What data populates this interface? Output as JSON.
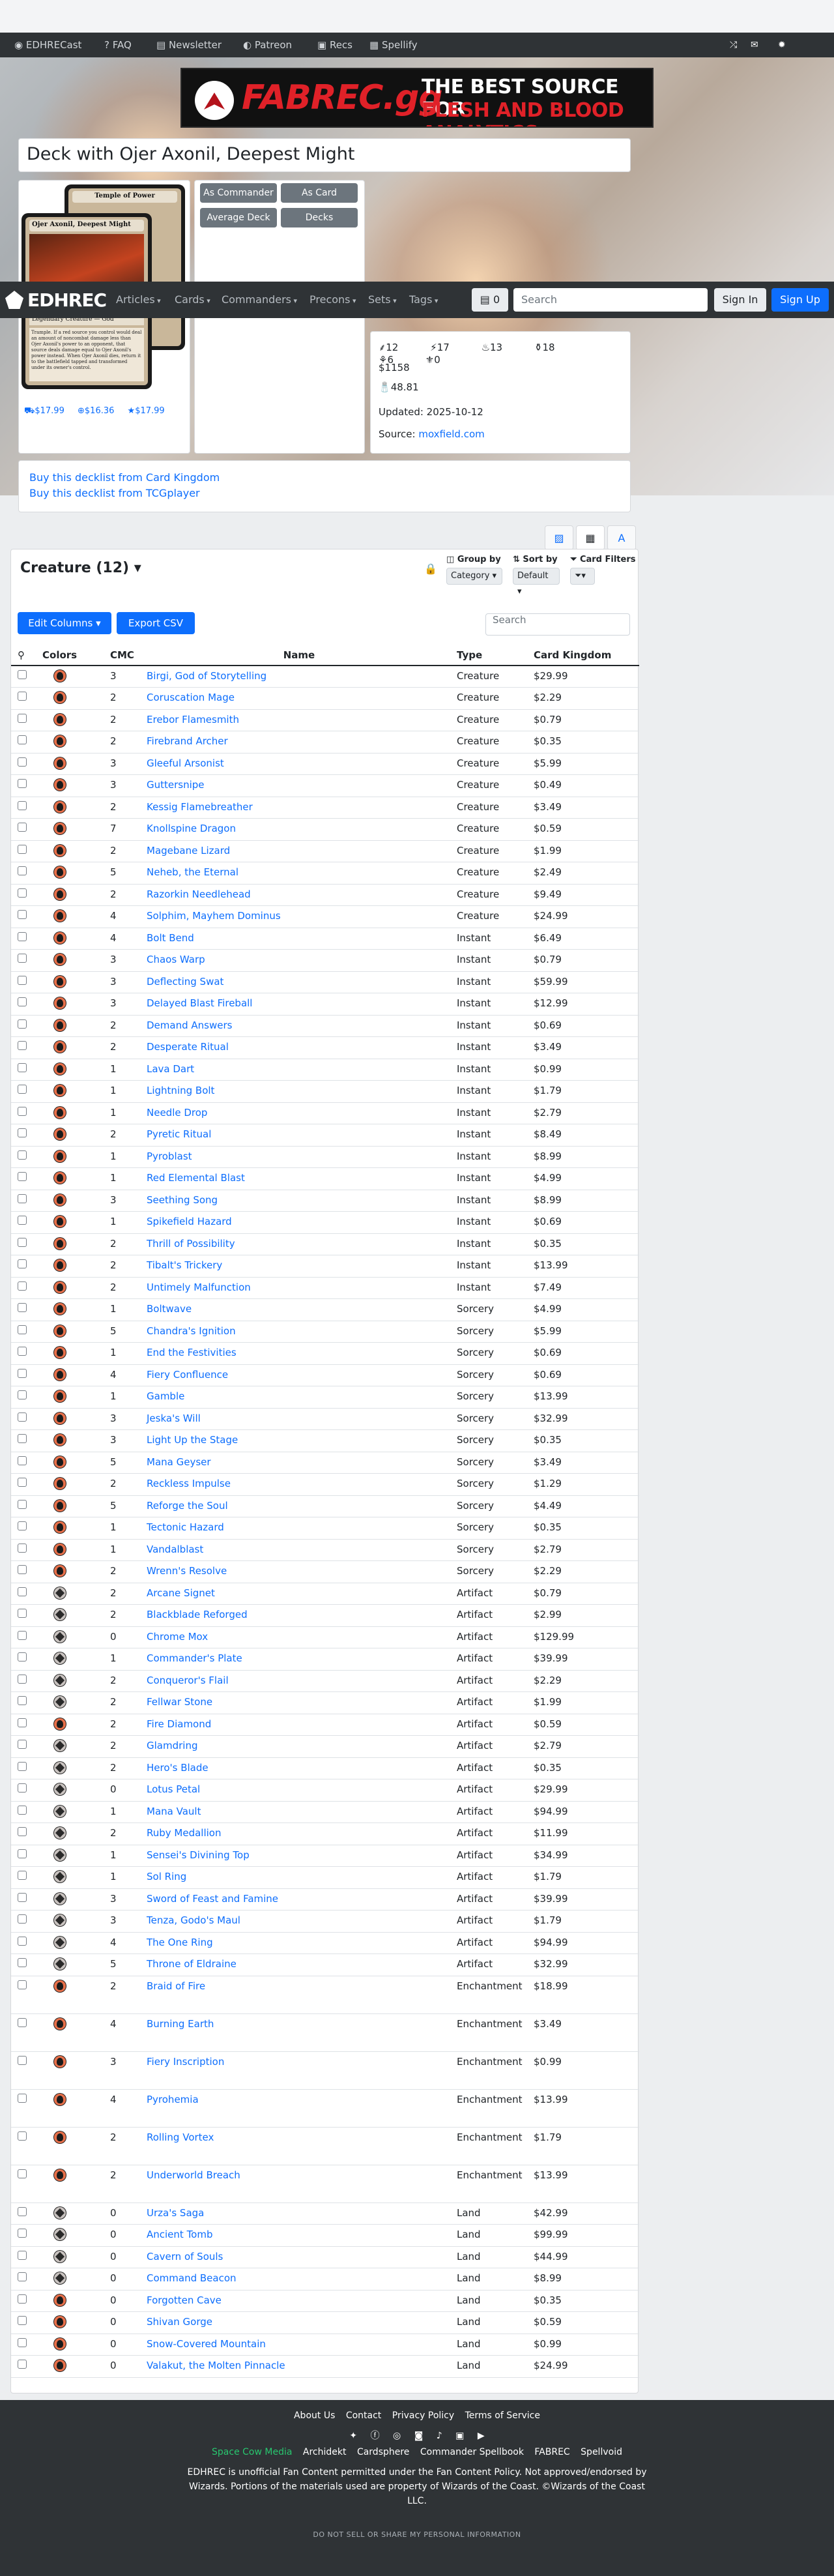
{
  "sitebar": {
    "items": [
      "EDHRECast",
      "FAQ",
      "Newsletter",
      "Patreon",
      "Recs",
      "Spellify"
    ]
  },
  "banner": {
    "brand": "FABREC.gg",
    "tag1": "THE BEST SOURCE FOR",
    "tag2": "FLESH AND BLOOD ANALYTICS"
  },
  "deck_title": "Deck with Ojer Axonil, Deepest Might",
  "card": {
    "name": "Ojer Axonil, Deepest Might",
    "back_name": "Temple of Power",
    "type": "Legendary Creature — God",
    "text": "Trample. If a red source you control would deal an amount of noncombat damage less than Ojer Axonil's power to an opponent, that source deals damage equal to Ojer Axonil's power instead. When Ojer Axonil dies, return it to the battlefield tapped and transformed under its owner's control."
  },
  "prices": [
    "$17.99",
    "$16.36",
    "$17.99"
  ],
  "buttons": {
    "as_commander": "As Commander",
    "as_card": "As Card",
    "average_deck": "Average Deck",
    "decks": "Decks"
  },
  "stats": {
    "counts": [
      "12",
      "17",
      "13",
      "18",
      "6",
      "0"
    ],
    "price": "$1158",
    "salt": "48.81",
    "updated": "Updated: 2025-10-12",
    "source_label": "Source:",
    "source_link": "moxfield.com"
  },
  "nav": {
    "logo": "EDHREC",
    "items": [
      "Articles",
      "Cards",
      "Commanders",
      "Precons",
      "Sets",
      "Tags"
    ],
    "deck_count": "0",
    "search_placeholder": "Search",
    "sign_in": "Sign In",
    "sign_up": "Sign Up"
  },
  "buy": {
    "ck": "Buy this decklist from Card Kingdom",
    "tcg": "Buy this decklist from TCGplayer"
  },
  "section": {
    "title": "Creature (12)",
    "group_by": "Group by",
    "group_val": "Category",
    "sort_by": "Sort by",
    "sort_val": "Default",
    "filters": "Card Filters",
    "edit_columns": "Edit Columns",
    "export": "Export CSV",
    "search_placeholder": "Search"
  },
  "table": {
    "headers": [
      "",
      "Colors",
      "CMC",
      "Name",
      "Type",
      "Card Kingdom"
    ],
    "rows": [
      [
        "r",
        "3",
        "Birgi, God of Storytelling",
        "Creature",
        "$29.99"
      ],
      [
        "r",
        "2",
        "Coruscation Mage",
        "Creature",
        "$2.29"
      ],
      [
        "r",
        "2",
        "Erebor Flamesmith",
        "Creature",
        "$0.79"
      ],
      [
        "r",
        "2",
        "Firebrand Archer",
        "Creature",
        "$0.35"
      ],
      [
        "r",
        "3",
        "Gleeful Arsonist",
        "Creature",
        "$5.99"
      ],
      [
        "r",
        "3",
        "Guttersnipe",
        "Creature",
        "$0.49"
      ],
      [
        "r",
        "2",
        "Kessig Flamebreather",
        "Creature",
        "$3.49"
      ],
      [
        "r",
        "7",
        "Knollspine Dragon",
        "Creature",
        "$0.59"
      ],
      [
        "r",
        "2",
        "Magebane Lizard",
        "Creature",
        "$1.99"
      ],
      [
        "r",
        "5",
        "Neheb, the Eternal",
        "Creature",
        "$2.49"
      ],
      [
        "r",
        "2",
        "Razorkin Needlehead",
        "Creature",
        "$9.49"
      ],
      [
        "r",
        "4",
        "Solphim, Mayhem Dominus",
        "Creature",
        "$24.99"
      ],
      [
        "r",
        "4",
        "Bolt Bend",
        "Instant",
        "$6.49"
      ],
      [
        "r",
        "3",
        "Chaos Warp",
        "Instant",
        "$0.79"
      ],
      [
        "r",
        "3",
        "Deflecting Swat",
        "Instant",
        "$59.99"
      ],
      [
        "r",
        "3",
        "Delayed Blast Fireball",
        "Instant",
        "$12.99"
      ],
      [
        "r",
        "2",
        "Demand Answers",
        "Instant",
        "$0.69"
      ],
      [
        "r",
        "2",
        "Desperate Ritual",
        "Instant",
        "$3.49"
      ],
      [
        "r",
        "1",
        "Lava Dart",
        "Instant",
        "$0.99"
      ],
      [
        "r",
        "1",
        "Lightning Bolt",
        "Instant",
        "$1.79"
      ],
      [
        "r",
        "1",
        "Needle Drop",
        "Instant",
        "$2.79"
      ],
      [
        "r",
        "2",
        "Pyretic Ritual",
        "Instant",
        "$8.49"
      ],
      [
        "r",
        "1",
        "Pyroblast",
        "Instant",
        "$8.99"
      ],
      [
        "r",
        "1",
        "Red Elemental Blast",
        "Instant",
        "$4.99"
      ],
      [
        "r",
        "3",
        "Seething Song",
        "Instant",
        "$8.99"
      ],
      [
        "r",
        "1",
        "Spikefield Hazard",
        "Instant",
        "$0.69"
      ],
      [
        "r",
        "2",
        "Thrill of Possibility",
        "Instant",
        "$0.35"
      ],
      [
        "r",
        "2",
        "Tibalt's Trickery",
        "Instant",
        "$13.99"
      ],
      [
        "r",
        "2",
        "Untimely Malfunction",
        "Instant",
        "$7.49"
      ],
      [
        "r",
        "1",
        "Boltwave",
        "Sorcery",
        "$4.99"
      ],
      [
        "r",
        "5",
        "Chandra's Ignition",
        "Sorcery",
        "$5.99"
      ],
      [
        "r",
        "1",
        "End the Festivities",
        "Sorcery",
        "$0.69"
      ],
      [
        "r",
        "4",
        "Fiery Confluence",
        "Sorcery",
        "$0.69"
      ],
      [
        "r",
        "1",
        "Gamble",
        "Sorcery",
        "$13.99"
      ],
      [
        "r",
        "3",
        "Jeska's Will",
        "Sorcery",
        "$32.99"
      ],
      [
        "r",
        "3",
        "Light Up the Stage",
        "Sorcery",
        "$0.35"
      ],
      [
        "r",
        "5",
        "Mana Geyser",
        "Sorcery",
        "$3.49"
      ],
      [
        "r",
        "2",
        "Reckless Impulse",
        "Sorcery",
        "$1.29"
      ],
      [
        "r",
        "5",
        "Reforge the Soul",
        "Sorcery",
        "$4.49"
      ],
      [
        "r",
        "1",
        "Tectonic Hazard",
        "Sorcery",
        "$0.35"
      ],
      [
        "r",
        "1",
        "Vandalblast",
        "Sorcery",
        "$2.79"
      ],
      [
        "r",
        "2",
        "Wrenn's Resolve",
        "Sorcery",
        "$2.29"
      ],
      [
        "c",
        "2",
        "Arcane Signet",
        "Artifact",
        "$0.79"
      ],
      [
        "c",
        "2",
        "Blackblade Reforged",
        "Artifact",
        "$2.99"
      ],
      [
        "c",
        "0",
        "Chrome Mox",
        "Artifact",
        "$129.99"
      ],
      [
        "c",
        "1",
        "Commander's Plate",
        "Artifact",
        "$39.99"
      ],
      [
        "c",
        "2",
        "Conqueror's Flail",
        "Artifact",
        "$2.29"
      ],
      [
        "c",
        "2",
        "Fellwar Stone",
        "Artifact",
        "$1.99"
      ],
      [
        "r",
        "2",
        "Fire Diamond",
        "Artifact",
        "$0.59"
      ],
      [
        "c",
        "2",
        "Glamdring",
        "Artifact",
        "$2.79"
      ],
      [
        "c",
        "2",
        "Hero's Blade",
        "Artifact",
        "$0.35"
      ],
      [
        "c",
        "0",
        "Lotus Petal",
        "Artifact",
        "$29.99"
      ],
      [
        "c",
        "1",
        "Mana Vault",
        "Artifact",
        "$94.99"
      ],
      [
        "c",
        "2",
        "Ruby Medallion",
        "Artifact",
        "$11.99"
      ],
      [
        "c",
        "1",
        "Sensei's Divining Top",
        "Artifact",
        "$34.99"
      ],
      [
        "c",
        "1",
        "Sol Ring",
        "Artifact",
        "$1.79"
      ],
      [
        "c",
        "3",
        "Sword of Feast and Famine",
        "Artifact",
        "$39.99"
      ],
      [
        "c",
        "3",
        "Tenza, Godo's Maul",
        "Artifact",
        "$1.79"
      ],
      [
        "c",
        "4",
        "The One Ring",
        "Artifact",
        "$94.99"
      ],
      [
        "c",
        "5",
        "Throne of Eldraine",
        "Artifact",
        "$32.99"
      ],
      [
        "r",
        "2",
        "Braid of Fire",
        "Enchantment",
        "$18.99"
      ],
      [
        "r",
        "4",
        "Burning Earth",
        "Enchantment",
        "$3.49"
      ],
      [
        "r",
        "3",
        "Fiery Inscription",
        "Enchantment",
        "$0.99"
      ],
      [
        "r",
        "4",
        "Pyrohemia",
        "Enchantment",
        "$13.99"
      ],
      [
        "r",
        "2",
        "Rolling Vortex",
        "Enchantment",
        "$1.79"
      ],
      [
        "r",
        "2",
        "Underworld Breach",
        "Enchantment",
        "$13.99"
      ],
      [
        "c",
        "0",
        "Urza's Saga",
        "Land",
        "$42.99"
      ],
      [
        "c",
        "0",
        "Ancient Tomb",
        "Land",
        "$99.99"
      ],
      [
        "c",
        "0",
        "Cavern of Souls",
        "Land",
        "$44.99"
      ],
      [
        "c",
        "0",
        "Command Beacon",
        "Land",
        "$8.99"
      ],
      [
        "r",
        "0",
        "Forgotten Cave",
        "Land",
        "$0.35"
      ],
      [
        "r",
        "0",
        "Shivan Gorge",
        "Land",
        "$0.59"
      ],
      [
        "r",
        "0",
        "Snow-Covered Mountain",
        "Land",
        "$0.99"
      ],
      [
        "r",
        "0",
        "Valakut, the Molten Pinnacle",
        "Land",
        "$24.99"
      ]
    ]
  },
  "footer": {
    "links": [
      "About Us",
      "Contact",
      "Privacy Policy",
      "Terms of Service"
    ],
    "family": [
      "Space Cow Media",
      "Archidekt",
      "Cardsphere",
      "Commander Spellbook",
      "FABREC",
      "Spellvoid"
    ],
    "legal": "EDHREC is unofficial Fan Content permitted under the Fan Content Policy. Not approved/endorsed by Wizards. Portions of the materials used are property of Wizards of the Coast. ©Wizards of the Coast LLC.",
    "dns": "DO NOT SELL OR SHARE MY PERSONAL INFORMATION"
  }
}
